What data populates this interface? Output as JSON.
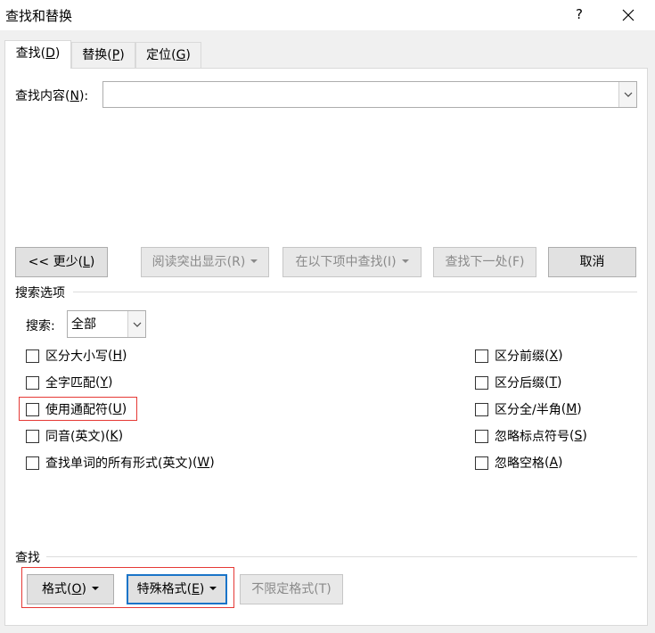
{
  "window": {
    "title": "查找和替换",
    "help_glyph": "?"
  },
  "tabs": [
    {
      "label": "查找",
      "key": "D"
    },
    {
      "label": "替换",
      "key": "P"
    },
    {
      "label": "定位",
      "key": "G"
    }
  ],
  "find": {
    "label": "查找内容",
    "key": "N",
    "value": ""
  },
  "buttons": {
    "less": {
      "label": "<< 更少",
      "key": "L"
    },
    "highlight": {
      "label": "阅读突出显示",
      "key": "R"
    },
    "find_in": {
      "label": "在以下项中查找",
      "key": "I"
    },
    "find_next": {
      "label": "查找下一处",
      "key": "F"
    },
    "cancel": {
      "label": "取消"
    }
  },
  "search_options": {
    "title": "搜索选项",
    "search_label": "搜索",
    "search_value": "全部",
    "left": [
      {
        "label": "区分大小写",
        "key": "H"
      },
      {
        "label": "全字匹配",
        "key": "Y"
      },
      {
        "label": "使用通配符",
        "key": "U"
      },
      {
        "label": "同音(英文)",
        "key": "K"
      },
      {
        "label": "查找单词的所有形式(英文)",
        "key": "W"
      }
    ],
    "right": [
      {
        "label": "区分前缀",
        "key": "X"
      },
      {
        "label": "区分后缀",
        "key": "T"
      },
      {
        "label": "区分全/半角",
        "key": "M"
      },
      {
        "label": "忽略标点符号",
        "key": "S"
      },
      {
        "label": "忽略空格",
        "key": "A"
      }
    ]
  },
  "find_section": {
    "title": "查找",
    "format": {
      "label": "格式",
      "key": "O"
    },
    "special": {
      "label": "特殊格式",
      "key": "E"
    },
    "no_format": {
      "label": "不限定格式",
      "key": "T"
    }
  },
  "colors": {
    "highlight_border": "#e53935",
    "focus_border": "#1a74c8"
  }
}
